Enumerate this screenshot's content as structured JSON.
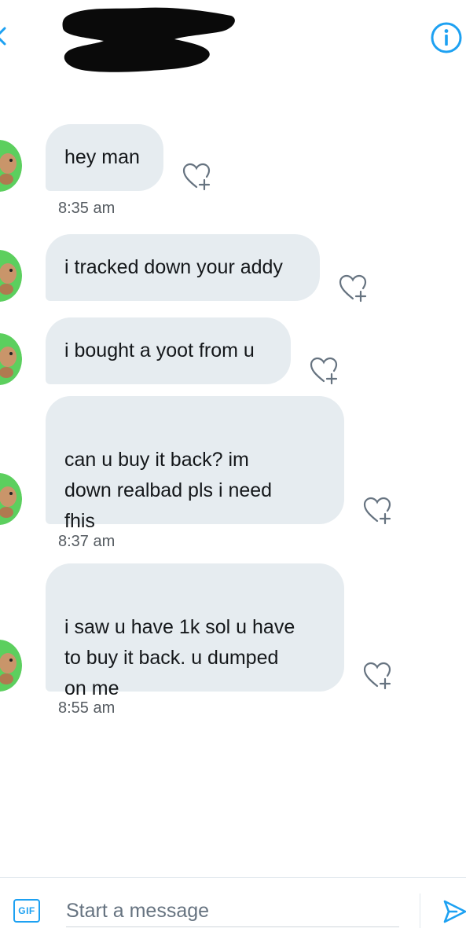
{
  "composer": {
    "gif_label": "GIF",
    "placeholder": "Start a message"
  },
  "messages": [
    {
      "text": "hey man",
      "time": "8:35 am"
    },
    {
      "text": "i tracked down your addy"
    },
    {
      "text": "i bought a yoot from u"
    },
    {
      "text": "can u buy it back? im\ndown realbad pls i need\nfhis",
      "time": "8:37 am"
    },
    {
      "text": "i saw u have 1k sol u have\nto buy it back. u dumped\non me",
      "time": "8:55 am"
    }
  ],
  "colors": {
    "accent": "#1da1f2",
    "bubble": "#e6ecf0",
    "avatar_bg": "#5ccf5e"
  },
  "icons": {
    "back": "back-arrow-icon",
    "info": "info-icon",
    "like": "heart-plus-icon",
    "send": "send-icon"
  }
}
